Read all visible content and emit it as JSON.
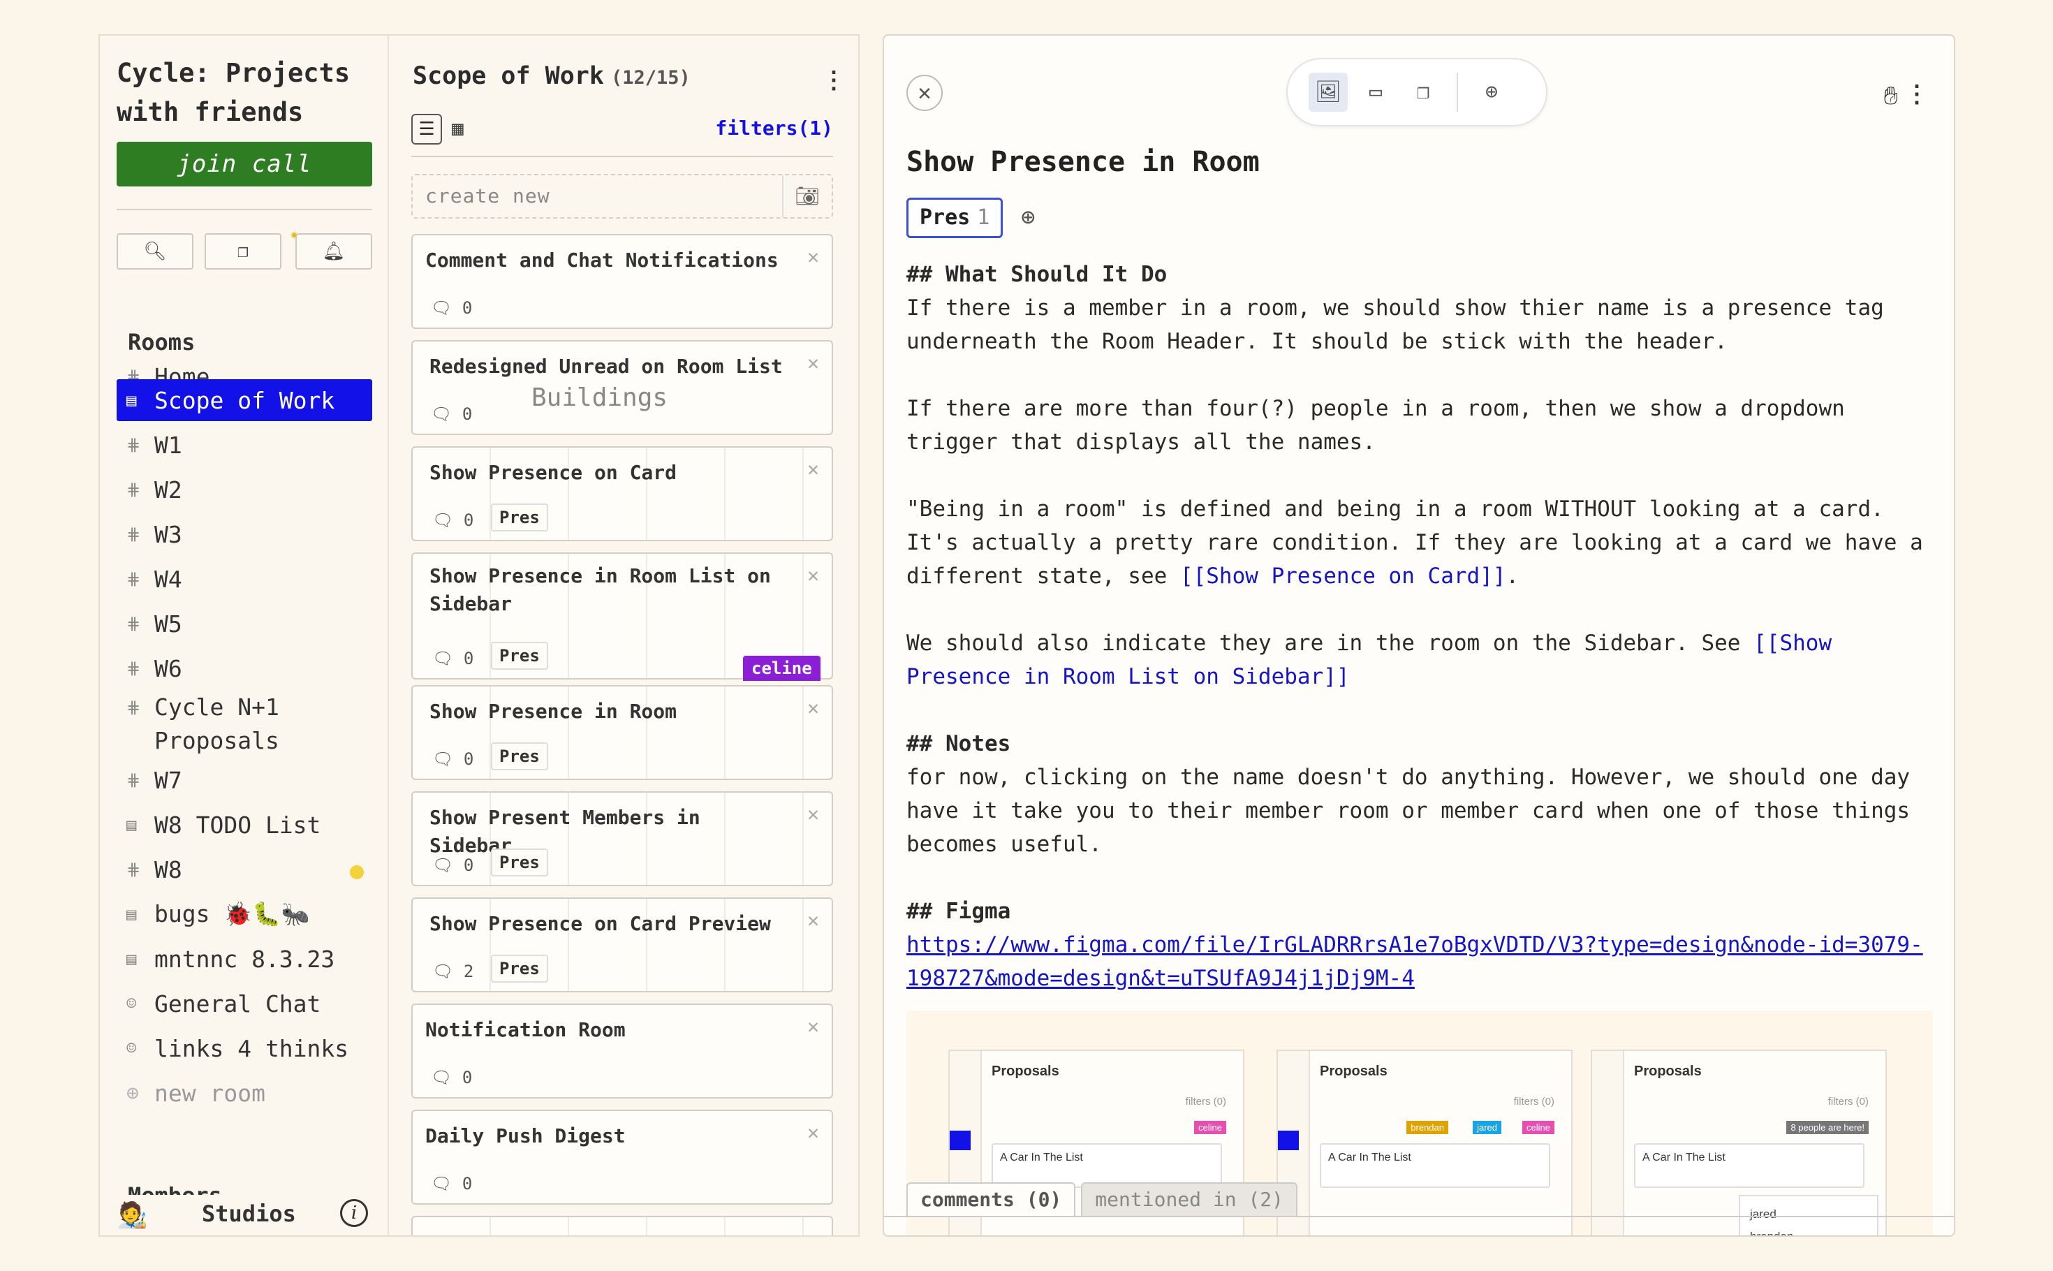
{
  "sidebar": {
    "cycle_title": "Cycle: Projects with friends",
    "join_call": "join call",
    "icon_buttons": [
      "search-icon",
      "card-stack-icon",
      "bell-icon"
    ],
    "rooms_heading": "Rooms",
    "rooms": [
      {
        "label": "Home",
        "icon": "#"
      },
      {
        "label": "Scope of Work",
        "icon": "▤",
        "active": true
      },
      {
        "label": "W1",
        "icon": "#"
      },
      {
        "label": "W2",
        "icon": "#"
      },
      {
        "label": "W3",
        "icon": "#"
      },
      {
        "label": "W4",
        "icon": "#"
      },
      {
        "label": "W5",
        "icon": "#"
      },
      {
        "label": "W6",
        "icon": "#"
      },
      {
        "label": "Cycle N+1 Proposals",
        "icon": "#"
      },
      {
        "label": "W7",
        "icon": "#"
      },
      {
        "label": "W8 TODO List",
        "icon": "▤"
      },
      {
        "label": "W8",
        "icon": "#",
        "unread": true
      },
      {
        "label": "bugs 🐞🐛🐜",
        "icon": "▤"
      },
      {
        "label": "mntnnc 8.3.23",
        "icon": "▤"
      },
      {
        "label": "General Chat",
        "icon": "☺"
      },
      {
        "label": "links 4 thinks",
        "icon": "☺"
      },
      {
        "label": "new room",
        "icon": "⊕"
      }
    ],
    "members_heading": "Members",
    "footer_label": "Studios",
    "info_glyph": "i"
  },
  "cardlist": {
    "title": "Scope of Work",
    "count": "(12/15)",
    "filters": "filters(1)",
    "create_new": "create new",
    "ghost_text": "Buildings",
    "celine_tag": "celine",
    "cards": [
      {
        "title": "Comment and Chat Notifications",
        "comments": "0"
      },
      {
        "title": "Redesigned Unread on Room List",
        "comments": "0"
      },
      {
        "title": "Show Presence on Card",
        "comments": "0",
        "tag": "Pres"
      },
      {
        "title": "Show Presence in Room List on Sidebar",
        "comments": "0",
        "tag": "Pres"
      },
      {
        "title": "Show Presence in Room",
        "comments": "0",
        "tag": "Pres"
      },
      {
        "title": "Show Present Members in Sidebar",
        "comments": "0",
        "tag": "Pres"
      },
      {
        "title": "Show Presence on Card Preview",
        "comments": "2",
        "tag": "Pres"
      },
      {
        "title": "Notification Room",
        "comments": "0"
      },
      {
        "title": "Daily Push Digest",
        "comments": "0"
      }
    ]
  },
  "detail": {
    "title": "Show Presence in Room",
    "tag_label": "Pres",
    "tag_count": "1",
    "paragraphs": [
      [
        {
          "t": "## What Should It Do",
          "c": "h"
        }
      ],
      [
        {
          "t": "If there is a member in a room, we should show thier name is a presence tag underneath the Room Header. It should be stick with the header."
        }
      ],
      [],
      [
        {
          "t": "If there are more than four(?) people in a room, then we show a dropdown trigger that displays all the names."
        }
      ],
      [],
      [
        {
          "t": "\"Being in a room\" is defined and being in a room WITHOUT looking at a card. It's actually a pretty rare condition. If they are looking at a card we have a different state, see "
        },
        {
          "t": "[[Show Presence on Card]]",
          "c": "lnk"
        },
        {
          "t": "."
        }
      ],
      [],
      [
        {
          "t": "We should also indicate they are in the room on the Sidebar. See "
        },
        {
          "t": "[[Show Presence in Room List on Sidebar]]",
          "c": "lnk"
        }
      ],
      [],
      [
        {
          "t": "## Notes",
          "c": "h"
        }
      ],
      [
        {
          "t": "for now, clicking on the name doesn't do anything. However, we should one day have it take you to their member room or member card when one of those things becomes useful."
        }
      ],
      [],
      [
        {
          "t": "## Figma",
          "c": "h"
        }
      ],
      [
        {
          "t": "https://www.figma.com/file/IrGLADRRrsA1e7oBgxVDTD/V3?type=design&node-id=3079-198727&mode=design&t=uTSUfA9J4j1jDj9M-4",
          "c": "url"
        }
      ]
    ],
    "figma_preview": {
      "panels": [
        {
          "title": "Proposals",
          "filters": "filters (0)",
          "card": "A Car In The List",
          "chips": [
            "celine"
          ]
        },
        {
          "title": "Proposals",
          "filters": "filters (0)",
          "card": "A Car In The List",
          "chips": [
            "brendan",
            "jared",
            "celine"
          ]
        },
        {
          "title": "Proposals",
          "filters": "filters (0)",
          "card": "A Car In The List",
          "chips": [
            "8 people are here!"
          ],
          "dropdown": [
            "jared",
            "brendan"
          ]
        }
      ]
    },
    "tabs": {
      "comments": "comments (0)",
      "mentioned": "mentioned in (2)"
    }
  },
  "colors": {
    "accent": "#1212e8",
    "join_green": "#2e7d22",
    "celine_purple": "#8c1fd6",
    "unread_dot": "#f3d23a",
    "background": "#fbf5ea"
  }
}
